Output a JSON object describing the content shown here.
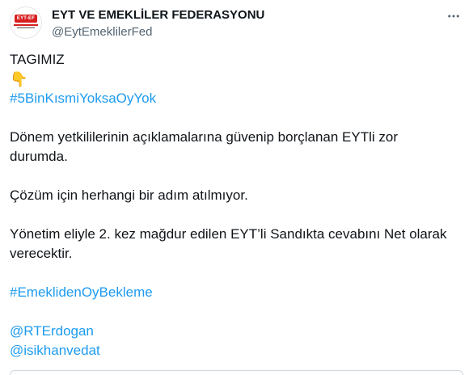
{
  "author": {
    "display_name": "EYT VE EMEKLİLER FEDERASYONU",
    "handle": "@EytEmeklilerFed",
    "logo_text": "EYT-EF"
  },
  "more_icon": "more-horizontal-icon",
  "tweet": {
    "l1": "TAGIMIZ",
    "emoji": "👇",
    "hashtag1": "#5BinKısmiYoksaOyYok",
    "p1a": "Dönem yetkililerinin açıklamalarına güvenip borçlanan EYTli zor",
    "p1b": "durumda.",
    "p2": "Çözüm için herhangi bir adım atılmıyor.",
    "p3a": "Yönetim eliyle 2. kez mağdur edilen EYT’li Sandıkta cevabını Net olarak",
    "p3b": "verecektir.",
    "hashtag2": "#EmeklidenOyBekleme",
    "mention1": "@RTErdogan",
    "mention2": "@isikhanvedat"
  },
  "colors": {
    "link": "#1d9bf0",
    "text": "#0f1419",
    "muted": "#536471",
    "brand": "#d71e1e"
  }
}
